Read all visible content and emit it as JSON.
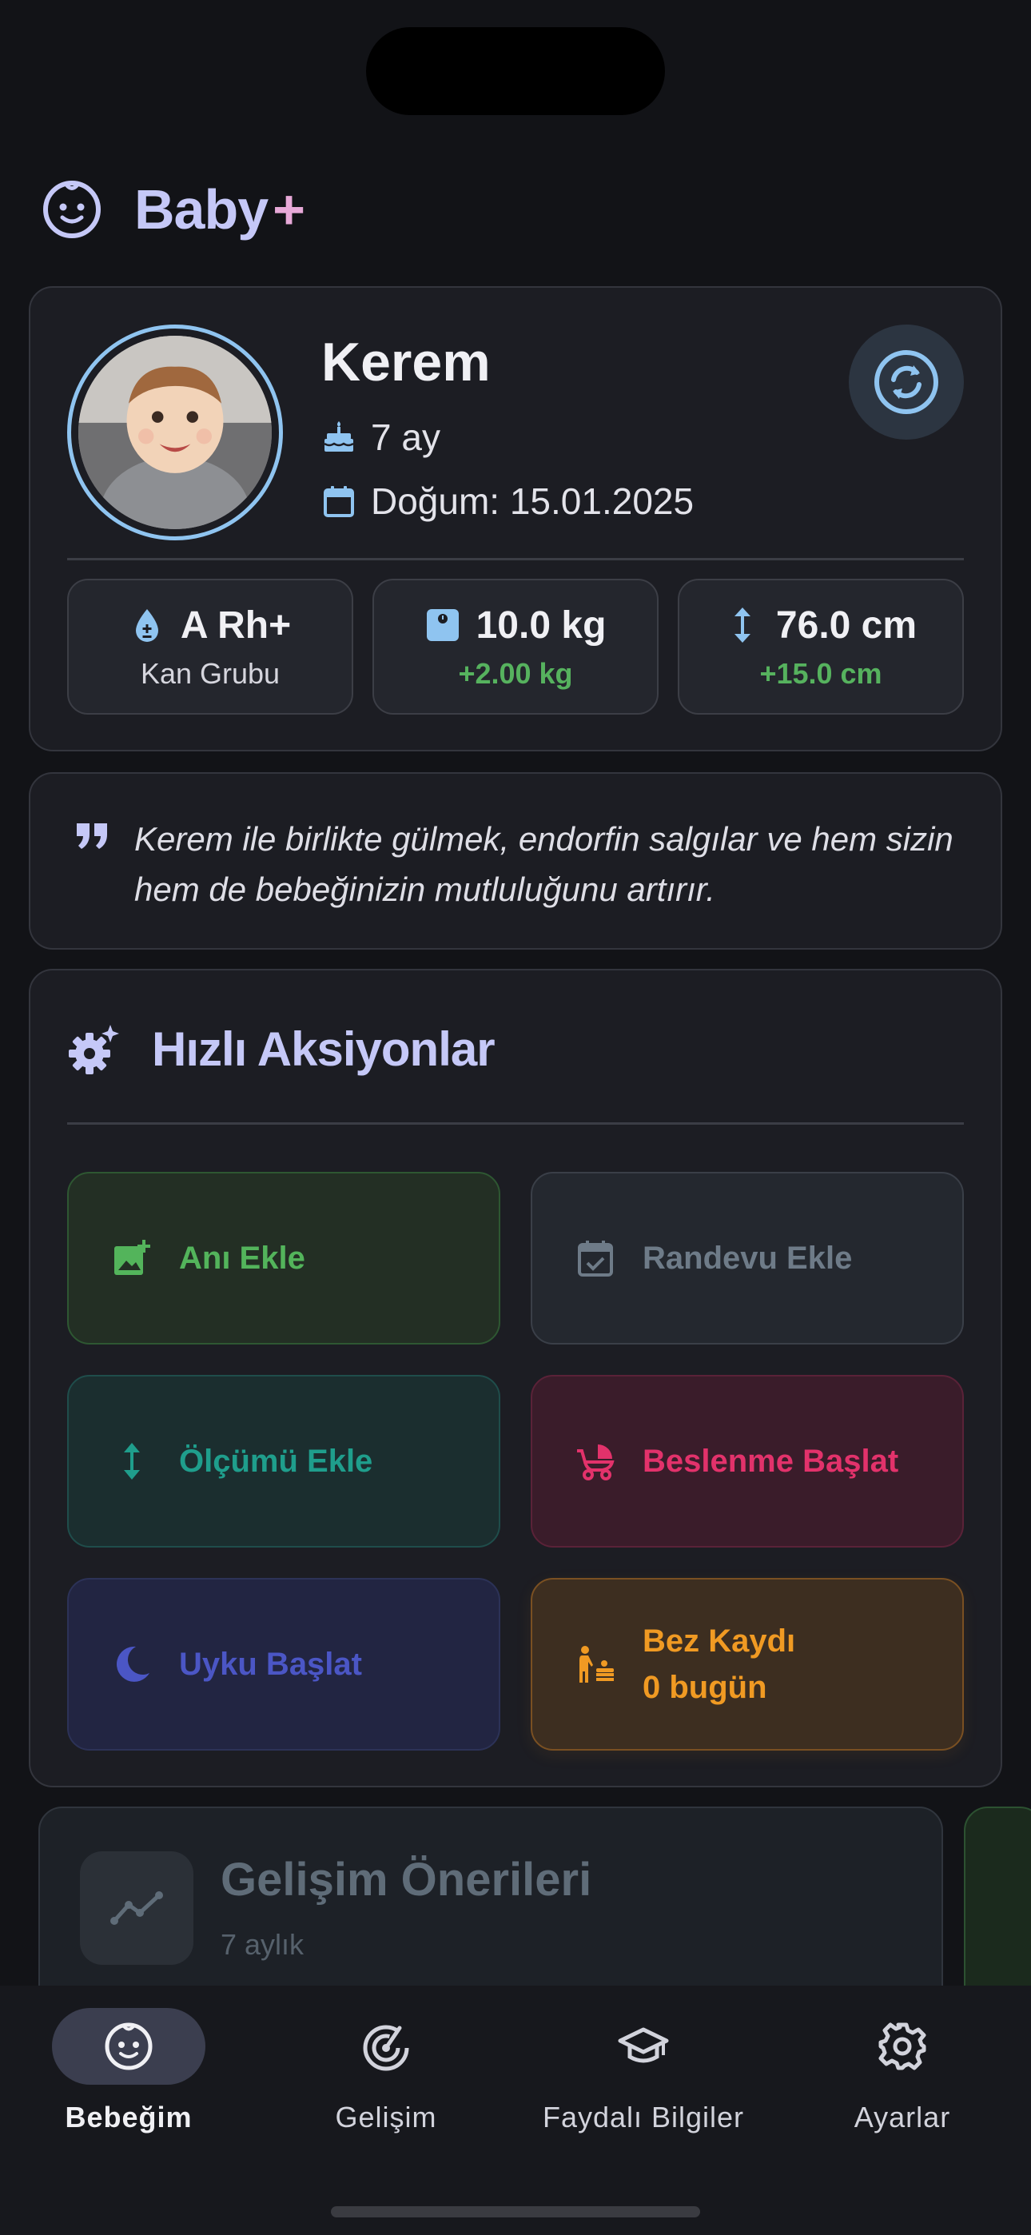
{
  "app": {
    "title": "Baby",
    "plus": "+"
  },
  "profile": {
    "name": "Kerem",
    "age": "7 ay",
    "birth": "Doğum: 15.01.2025",
    "stats": [
      {
        "value": "A Rh+",
        "sub": "Kan Grubu",
        "icon": "blood-drop-icon"
      },
      {
        "value": "10.0 kg",
        "sub": "+2.00 kg",
        "icon": "scale-icon"
      },
      {
        "value": "76.0 cm",
        "sub": "+15.0 cm",
        "icon": "height-arrow-icon"
      }
    ]
  },
  "quote": {
    "text": "Kerem ile birlikte gülmek, endorfin salgılar ve hem sizin hem de bebeğinizin mutluluğunu artırır."
  },
  "quick_actions": {
    "title": "Hızlı Aksiyonlar",
    "items": [
      {
        "label": "Anı Ekle",
        "icon": "add-photo-icon",
        "color": "#53b45b"
      },
      {
        "label": "Randevu Ekle",
        "icon": "calendar-check-icon",
        "color": "#6e7b88"
      },
      {
        "label": "Ölçümü Ekle",
        "icon": "vertical-arrows-icon",
        "color": "#1f9e8c"
      },
      {
        "label": "Beslenme Başlat",
        "icon": "stroller-icon",
        "color": "#e2326b"
      },
      {
        "label": "Uyku Başlat",
        "icon": "moon-icon",
        "color": "#4b56c5"
      },
      {
        "label": "Bez Kaydı",
        "label2": "0 bugün",
        "icon": "baby-changing-icon",
        "color": "#f09a23"
      }
    ]
  },
  "development": {
    "title": "Gelişim Önerileri",
    "subtitle": "7 aylık"
  },
  "nav": [
    {
      "label": "Bebeğim",
      "icon": "baby-face-icon",
      "active": true
    },
    {
      "label": "Gelişim",
      "icon": "radar-icon",
      "active": false
    },
    {
      "label": "Faydalı Bilgiler",
      "icon": "graduation-cap-icon",
      "active": false
    },
    {
      "label": "Ayarlar",
      "icon": "gear-icon",
      "active": false
    }
  ],
  "colors": {
    "accent": "#c5c8f7",
    "plus": "#e7a9d8",
    "info_icon": "#8fc4f0",
    "positive": "#56b25e"
  }
}
